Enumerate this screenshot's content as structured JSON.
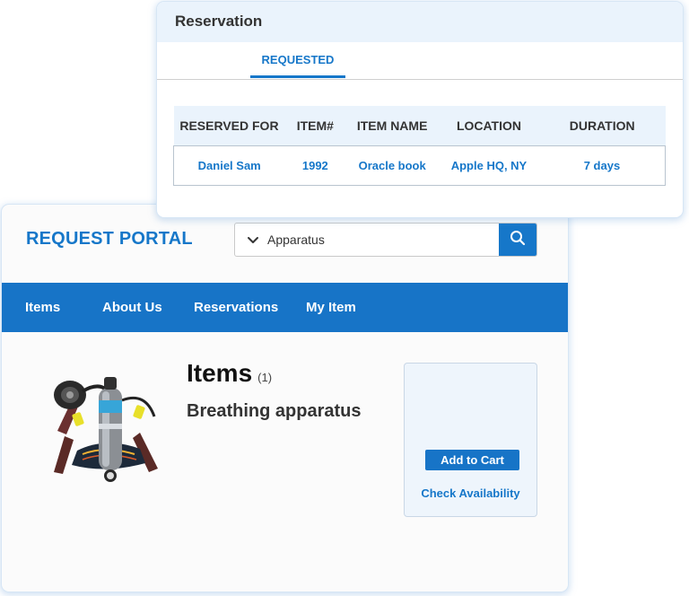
{
  "portal": {
    "title": "REQUEST PORTAL",
    "search": {
      "value": "Apparatus",
      "placeholder": "",
      "dropdown_icon": "chevron-down-icon",
      "button_icon": "search-icon"
    },
    "nav": [
      {
        "label": "Items"
      },
      {
        "label": "About Us"
      },
      {
        "label": "Reservations"
      },
      {
        "label": "My Item"
      }
    ],
    "content": {
      "heading": "Items",
      "count": "(1)",
      "product_name": "Breathing apparatus",
      "product_image": "breathing-apparatus-image"
    },
    "cart": {
      "add_label": "Add to Cart",
      "check_label": "Check Availability"
    }
  },
  "reservation": {
    "title": "Reservation",
    "tab": "REQUESTED",
    "columns": [
      "RESERVED FOR",
      "ITEM#",
      "ITEM NAME",
      "LOCATION",
      "DURATION"
    ],
    "rows": [
      {
        "reserved_for": "Daniel Sam",
        "item_no": "1992",
        "item_name": "Oracle book",
        "location": "Apple HQ, NY",
        "duration": "7 days"
      }
    ]
  },
  "colors": {
    "brand_blue": "#1774c7",
    "link_blue": "#1677c9",
    "header_tint": "#eaf3fc"
  }
}
